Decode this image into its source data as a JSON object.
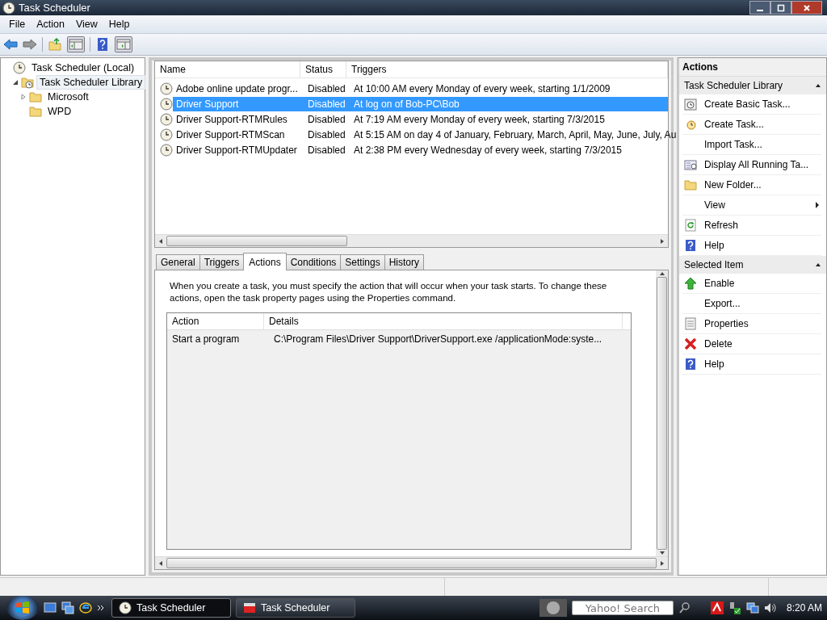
{
  "window": {
    "title": "Task Scheduler"
  },
  "menu": [
    "File",
    "Action",
    "View",
    "Help"
  ],
  "tree": [
    {
      "label": "Task Scheduler (Local)",
      "selected": false,
      "kind": "clock",
      "children": [
        {
          "label": "Task Scheduler Library",
          "selected": true,
          "expanded": true,
          "kind": "clock-folder",
          "children": [
            {
              "label": "Microsoft",
              "selected": false,
              "expanded": false,
              "kind": "folder"
            },
            {
              "label": "WPD",
              "selected": false,
              "kind": "folder"
            }
          ]
        }
      ]
    }
  ],
  "task_list": {
    "columns": [
      "Name",
      "Status",
      "Triggers"
    ],
    "rows": [
      {
        "name": "Adobe online update progr...",
        "status": "Disabled",
        "trigger": "At 10:00 AM every Monday of every week, starting 1/1/2009",
        "selected": false
      },
      {
        "name": "Driver Support",
        "status": "Disabled",
        "trigger": "At log on of Bob-PC\\Bob",
        "selected": true
      },
      {
        "name": "Driver Support-RTMRules",
        "status": "Disabled",
        "trigger": "At 7:19 AM every Monday of every week, starting 7/3/2015",
        "selected": false
      },
      {
        "name": "Driver Support-RTMScan",
        "status": "Disabled",
        "trigger": "At 5:15 AM  on day 4 of January, February, March, April, May, June, July, Au",
        "selected": false
      },
      {
        "name": "Driver Support-RTMUpdater",
        "status": "Disabled",
        "trigger": "At 2:38 PM every Wednesday of every week, starting 7/3/2015",
        "selected": false
      }
    ]
  },
  "tabs": [
    {
      "label": "General",
      "selected": false
    },
    {
      "label": "Triggers",
      "selected": false
    },
    {
      "label": "Actions",
      "selected": true
    },
    {
      "label": "Conditions",
      "selected": false
    },
    {
      "label": "Settings",
      "selected": false
    },
    {
      "label": "History",
      "selected": false
    }
  ],
  "actions_tab": {
    "description": "When you create a task, you must specify the action that will occur when your task starts.  To change these actions, open the task property pages using the Properties command.",
    "columns": [
      "Action",
      "Details"
    ],
    "rows": [
      {
        "action": "Start a program",
        "details": "C:\\Program Files\\Driver Support\\DriverSupport.exe /applicationMode:syste..."
      }
    ]
  },
  "actions_pane": {
    "title": "Actions",
    "sections": [
      {
        "title": "Task Scheduler Library",
        "expanded": true,
        "items": [
          {
            "label": "Create Basic Task...",
            "kind": "basic-task"
          },
          {
            "label": "Create Task...",
            "kind": "create-task"
          },
          {
            "label": "Import Task...",
            "kind": "plain"
          },
          {
            "label": "Display All Running Ta...",
            "kind": "running"
          },
          {
            "label": "New Folder...",
            "kind": "folder"
          },
          {
            "label": "View",
            "kind": "submenu"
          },
          {
            "label": "Refresh",
            "kind": "refresh"
          },
          {
            "label": "Help",
            "kind": "help"
          }
        ]
      },
      {
        "title": "Selected Item",
        "expanded": true,
        "items": [
          {
            "label": "Enable",
            "kind": "enable"
          },
          {
            "label": "Export...",
            "kind": "plain"
          },
          {
            "label": "Properties",
            "kind": "properties"
          },
          {
            "label": "Delete",
            "kind": "delete"
          },
          {
            "label": "Help",
            "kind": "help"
          }
        ]
      }
    ]
  },
  "taskbar": {
    "buttons": [
      {
        "label": "Task Scheduler",
        "selected": true,
        "kind": "clock"
      },
      {
        "label": "Task Scheduler",
        "selected": false,
        "kind": "toolbox"
      }
    ],
    "search": {
      "placeholder": "Yahoo! Search"
    },
    "clock": "8:20 AM"
  }
}
